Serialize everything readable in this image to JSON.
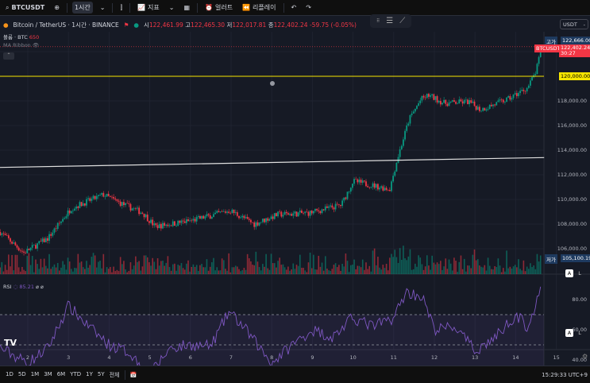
{
  "toolbar": {
    "symbol": "BTCUSDT",
    "interval": "1시간",
    "indicators": "지표",
    "alert": "얼러트",
    "replay": "리플레이"
  },
  "legend": {
    "title": "Bitcoin / TetherUS · 1시간 · BINANCE",
    "o_label": "시",
    "o": "122,461.99",
    "h_label": "고",
    "h": "122,465.30",
    "l_label": "저",
    "l": "122,017.81",
    "c_label": "종",
    "c": "122,402.24",
    "change": "-59.75 (-0.05%)",
    "volume_label": "볼륨 · BTC",
    "volume": "650",
    "ma_ribbon": "MA Ribbon"
  },
  "currency": "USDT",
  "price_axis": {
    "labels": [
      "118,000.00",
      "116,000.00",
      "114,000.00",
      "112,000.00",
      "110,000.00",
      "108,000.00",
      "106,000.00"
    ],
    "high_label": "고가",
    "high": "122,666.00",
    "symbol_tag": "BTCUSDT",
    "last": "122,402.24",
    "countdown": "30:27",
    "line_level": "120,000.00",
    "low_label": "저가",
    "low": "105,100.19"
  },
  "rsi": {
    "label": "RSI",
    "value": "85.21",
    "axis": [
      "80.00",
      "60.00",
      "40.00"
    ]
  },
  "time_axis": [
    "2",
    "3",
    "4",
    "5",
    "6",
    "7",
    "8",
    "9",
    "10",
    "11",
    "12",
    "13",
    "14",
    "15"
  ],
  "ranges": [
    "1D",
    "5D",
    "1M",
    "3M",
    "6M",
    "YTD",
    "1Y",
    "5Y",
    "전체"
  ],
  "clock": "15:29:33 UTC+9",
  "colors": {
    "up": "#089981",
    "down": "#f23645",
    "rsi": "#7e57c2",
    "level": "#f7e600"
  },
  "chart_data": {
    "type": "candlestick",
    "x_unit": "day",
    "price_points": [
      [
        1.32,
        107355
      ],
      [
        1.9,
        105677
      ],
      [
        2.49,
        106839
      ],
      [
        3.07,
        109290
      ],
      [
        3.86,
        110387
      ],
      [
        4.25,
        109742
      ],
      [
        4.83,
        108903
      ],
      [
        5.13,
        107806
      ],
      [
        6.0,
        108258
      ],
      [
        6.98,
        109097
      ],
      [
        7.57,
        108000
      ],
      [
        8.15,
        108774
      ],
      [
        8.93,
        108903
      ],
      [
        9.71,
        109548
      ],
      [
        10.0,
        111484
      ],
      [
        10.9,
        110839
      ],
      [
        11.1,
        113419
      ],
      [
        11.38,
        116516
      ],
      [
        11.67,
        118129
      ],
      [
        11.86,
        118452
      ],
      [
        12.25,
        117806
      ],
      [
        12.84,
        117935
      ],
      [
        13.13,
        117290
      ],
      [
        13.81,
        118129
      ],
      [
        14.3,
        119097
      ],
      [
        14.5,
        120387
      ],
      [
        14.63,
        122194
      ]
    ],
    "rsi_points": [
      [
        1.32,
        48
      ],
      [
        2.0,
        38
      ],
      [
        2.5,
        48
      ],
      [
        3.0,
        76
      ],
      [
        3.5,
        62
      ],
      [
        4.0,
        50
      ],
      [
        4.5,
        45
      ],
      [
        5.0,
        30
      ],
      [
        5.5,
        48
      ],
      [
        6.0,
        50
      ],
      [
        6.5,
        49
      ],
      [
        6.95,
        72
      ],
      [
        7.3,
        62
      ],
      [
        8.0,
        38
      ],
      [
        8.5,
        50
      ],
      [
        9.0,
        60
      ],
      [
        9.5,
        55
      ],
      [
        10.0,
        68
      ],
      [
        10.5,
        62
      ],
      [
        11.0,
        68
      ],
      [
        11.3,
        85
      ],
      [
        11.7,
        82
      ],
      [
        12.0,
        60
      ],
      [
        12.5,
        62
      ],
      [
        13.0,
        46
      ],
      [
        13.5,
        55
      ],
      [
        14.0,
        70
      ],
      [
        14.3,
        62
      ],
      [
        14.63,
        86
      ]
    ],
    "horizontal_level": 120000,
    "trendline": [
      [
        1.32,
        112600
      ],
      [
        14.7,
        113400
      ]
    ],
    "ylim": [
      105000,
      122700
    ],
    "rsi_ylim": [
      20,
      95
    ]
  }
}
